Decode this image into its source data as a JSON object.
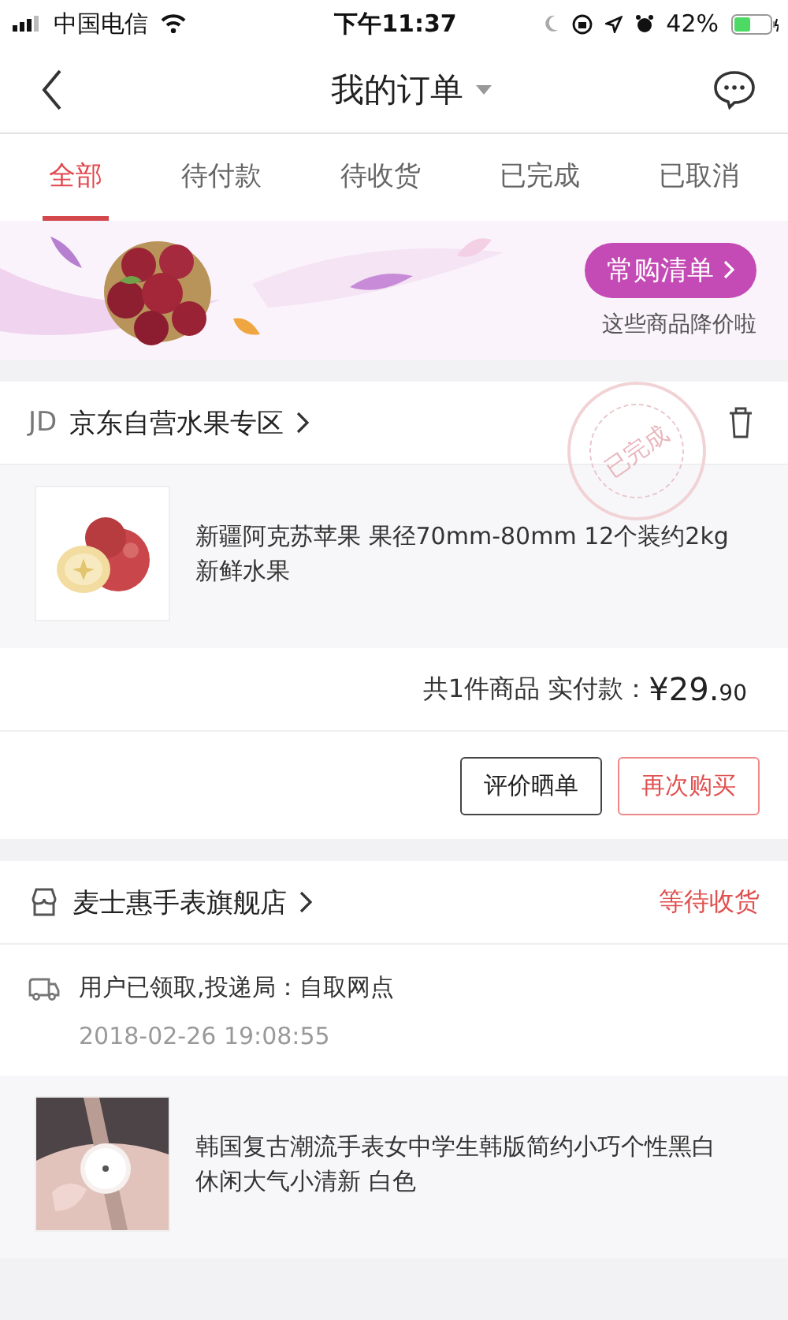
{
  "status_bar": {
    "carrier": "中国电信",
    "time": "下午11:37",
    "battery": "42%"
  },
  "nav": {
    "title": "我的订单"
  },
  "tabs": [
    {
      "label": "全部",
      "selected": true
    },
    {
      "label": "待付款",
      "selected": false
    },
    {
      "label": "待收货",
      "selected": false
    },
    {
      "label": "已完成",
      "selected": false
    },
    {
      "label": "已取消",
      "selected": false
    }
  ],
  "banner": {
    "kind": "picture",
    "button": "常购清单",
    "caption": "这些商品降价啦"
  },
  "orders": [
    {
      "kind": "self_run",
      "store_logo": "JD",
      "store": "京东自营水果专区",
      "stamp": "已完成",
      "product": {
        "kind": "picture",
        "title": "新疆阿克苏苹果 果径70mm-80mm 12个装约2kg 新鲜水果"
      },
      "summary": "共1件商品 实付款：",
      "price_main": "¥29.",
      "price_cents": "90",
      "buttons": [
        {
          "label": "评价晒单",
          "kind": "plain"
        },
        {
          "label": "再次购买",
          "kind": "accent"
        }
      ]
    },
    {
      "kind": "shop",
      "store": "麦士惠手表旗舰店",
      "status": "等待收货",
      "delivery": {
        "text": "用户已领取,投递局：自取网点",
        "time": "2018-02-26 19:08:55"
      },
      "product": {
        "kind": "picture",
        "title": "韩国复古潮流手表女中学生韩版简约小巧个性黑白休闲大气小清新 白色"
      }
    }
  ]
}
